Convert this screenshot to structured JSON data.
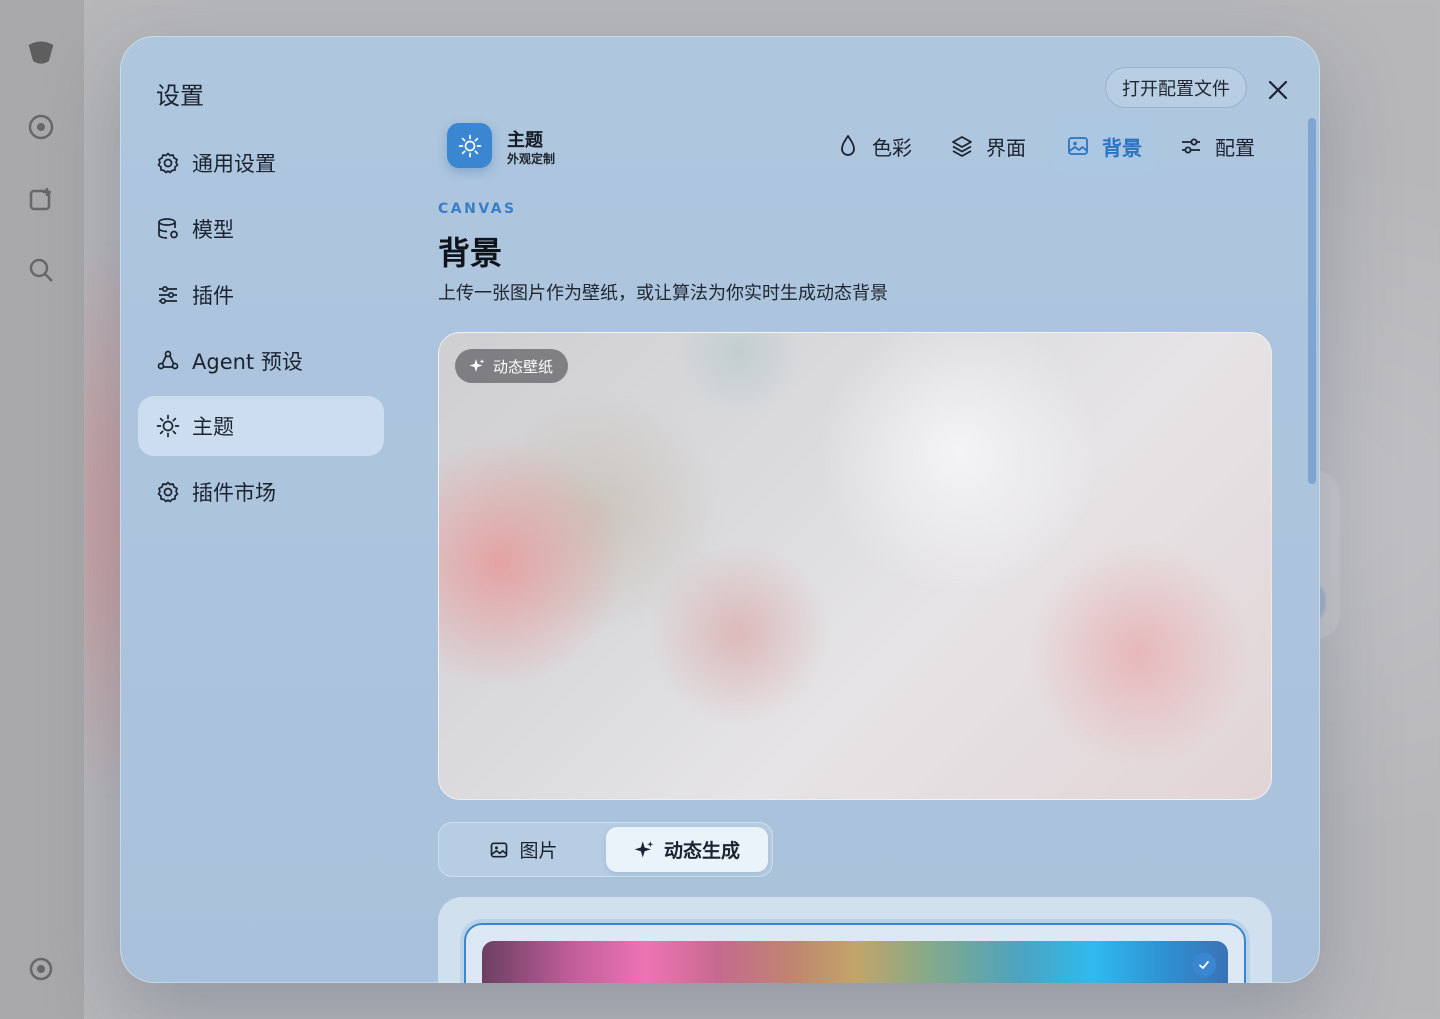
{
  "modal": {
    "title": "设置",
    "open_config_label": "打开配置文件"
  },
  "sidebar": {
    "items": [
      {
        "label": "通用设置",
        "icon": "gear-icon"
      },
      {
        "label": "模型",
        "icon": "database-icon"
      },
      {
        "label": "插件",
        "icon": "sliders-icon"
      },
      {
        "label": "Agent 预设",
        "icon": "agent-icon"
      },
      {
        "label": "主题",
        "icon": "sun-icon",
        "active": true
      },
      {
        "label": "插件市场",
        "icon": "gear-icon"
      }
    ]
  },
  "header": {
    "theme_name": "主题",
    "theme_sub": "外观定制",
    "tabs": [
      {
        "label": "色彩",
        "icon": "droplet-icon"
      },
      {
        "label": "界面",
        "icon": "layers-icon"
      },
      {
        "label": "背景",
        "icon": "image-icon",
        "active": true
      },
      {
        "label": "配置",
        "icon": "sliders-icon"
      }
    ]
  },
  "section": {
    "eyebrow": "CANVAS",
    "title": "背景",
    "description": "上传一张图片作为壁纸，或让算法为你实时生成动态背景",
    "preview_tag": "动态壁纸"
  },
  "segmented": {
    "image_label": "图片",
    "dynamic_label": "动态生成",
    "selected": "动态生成"
  },
  "colors": {
    "accent": "#3a86d0",
    "modal_bg": "#aec6de"
  }
}
